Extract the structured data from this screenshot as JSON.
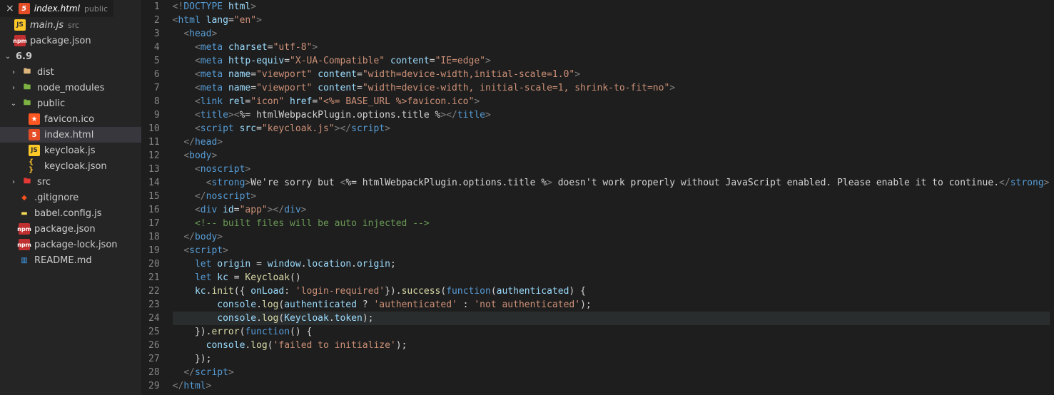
{
  "tabs": {
    "active": {
      "name": "index.html",
      "meta": "public"
    }
  },
  "breadcrumb": {
    "file": "main.js",
    "meta": "src"
  },
  "packagecrumb": {
    "file": "package.json"
  },
  "explorer": {
    "root": "6.9",
    "items": [
      {
        "type": "folder",
        "name": "dist",
        "expanded": false,
        "iconCls": "i-folder"
      },
      {
        "type": "folder",
        "name": "node_modules",
        "expanded": false,
        "iconCls": "i-foldergreen"
      },
      {
        "type": "folder",
        "name": "public",
        "expanded": true,
        "iconCls": "i-foldergreen",
        "children": [
          {
            "name": "favicon.ico",
            "iconCls": "i-fav",
            "glyph": "★"
          },
          {
            "name": "index.html",
            "iconCls": "i-html5",
            "glyph": "5",
            "selected": true
          },
          {
            "name": "keycloak.js",
            "iconCls": "i-js",
            "glyph": "JS"
          },
          {
            "name": "keycloak.json",
            "iconCls": "i-json",
            "glyph": "{ }"
          }
        ]
      },
      {
        "type": "folder",
        "name": "src",
        "expanded": false,
        "iconCls": "i-folderred"
      },
      {
        "type": "file",
        "name": ".gitignore",
        "iconCls": "i-git",
        "glyph": "◆"
      },
      {
        "type": "file",
        "name": "babel.config.js",
        "iconCls": "i-babel",
        "glyph": "▬"
      },
      {
        "type": "file",
        "name": "package.json",
        "iconCls": "i-npm",
        "glyph": "npm"
      },
      {
        "type": "file",
        "name": "package-lock.json",
        "iconCls": "i-npm",
        "glyph": "npm"
      },
      {
        "type": "file",
        "name": "README.md",
        "iconCls": "i-md",
        "glyph": "▥"
      }
    ]
  },
  "code": {
    "currentLine": 24,
    "lines": [
      {
        "n": 1,
        "html": "<span class='tk-pun'>&lt;!</span><span class='tk-doc'>DOCTYPE</span> <span class='tk-attr'>html</span><span class='tk-pun'>&gt;</span>"
      },
      {
        "n": 2,
        "html": "<span class='tk-pun'>&lt;</span><span class='tk-tag'>html</span> <span class='tk-attr'>lang</span><span class='tk-txt'>=</span><span class='tk-str'>\"en\"</span><span class='tk-pun'>&gt;</span>"
      },
      {
        "n": 3,
        "html": "  <span class='tk-pun'>&lt;</span><span class='tk-tag'>head</span><span class='tk-pun'>&gt;</span>"
      },
      {
        "n": 4,
        "html": "    <span class='tk-pun'>&lt;</span><span class='tk-tag'>meta</span> <span class='tk-attr'>charset</span><span class='tk-txt'>=</span><span class='tk-str'>\"utf-8\"</span><span class='tk-pun'>&gt;</span>"
      },
      {
        "n": 5,
        "html": "    <span class='tk-pun'>&lt;</span><span class='tk-tag'>meta</span> <span class='tk-attr'>http-equiv</span><span class='tk-txt'>=</span><span class='tk-str'>\"X-UA-Compatible\"</span> <span class='tk-attr'>content</span><span class='tk-txt'>=</span><span class='tk-str'>\"IE=edge\"</span><span class='tk-pun'>&gt;</span>"
      },
      {
        "n": 6,
        "html": "    <span class='tk-pun'>&lt;</span><span class='tk-tag'>meta</span> <span class='tk-attr'>name</span><span class='tk-txt'>=</span><span class='tk-str'>\"viewport\"</span> <span class='tk-attr'>content</span><span class='tk-txt'>=</span><span class='tk-str'>\"width=device-width,initial-scale=1.0\"</span><span class='tk-pun'>&gt;</span>"
      },
      {
        "n": 7,
        "html": "    <span class='tk-pun'>&lt;</span><span class='tk-tag'>meta</span> <span class='tk-attr'>name</span><span class='tk-txt'>=</span><span class='tk-str'>\"viewport\"</span> <span class='tk-attr'>content</span><span class='tk-txt'>=</span><span class='tk-str'>\"width=device-width, initial-scale=1, shrink-to-fit=no\"</span><span class='tk-pun'>&gt;</span>"
      },
      {
        "n": 8,
        "html": "    <span class='tk-pun'>&lt;</span><span class='tk-tag'>link</span> <span class='tk-attr'>rel</span><span class='tk-txt'>=</span><span class='tk-str'>\"icon\"</span> <span class='tk-attr'>href</span><span class='tk-txt'>=</span><span class='tk-str'>\"&lt;%= BASE_URL %&gt;favicon.ico\"</span><span class='tk-pun'>&gt;</span>"
      },
      {
        "n": 9,
        "html": "    <span class='tk-pun'>&lt;</span><span class='tk-tag'>title</span><span class='tk-pun'>&gt;&lt;</span><span class='tk-txt'>%= htmlWebpackPlugin.options.title %</span><span class='tk-pun'>&gt;&lt;/</span><span class='tk-tag'>title</span><span class='tk-pun'>&gt;</span>"
      },
      {
        "n": 10,
        "html": "    <span class='tk-pun'>&lt;</span><span class='tk-tag'>script</span> <span class='tk-attr'>src</span><span class='tk-txt'>=</span><span class='tk-str'>\"keycloak.js\"</span><span class='tk-pun'>&gt;&lt;/</span><span class='tk-tag'>script</span><span class='tk-pun'>&gt;</span>"
      },
      {
        "n": 11,
        "html": "  <span class='tk-pun'>&lt;/</span><span class='tk-tag'>head</span><span class='tk-pun'>&gt;</span>"
      },
      {
        "n": 12,
        "html": "  <span class='tk-pun'>&lt;</span><span class='tk-tag'>body</span><span class='tk-pun'>&gt;</span>"
      },
      {
        "n": 13,
        "html": "    <span class='tk-pun'>&lt;</span><span class='tk-tag'>noscript</span><span class='tk-pun'>&gt;</span>"
      },
      {
        "n": 14,
        "html": "      <span class='tk-pun'>&lt;</span><span class='tk-tag'>strong</span><span class='tk-pun'>&gt;</span><span class='tk-txt'>We're sorry but </span><span class='tk-pun'>&lt;</span><span class='tk-txt'>%= htmlWebpackPlugin.options.title %</span><span class='tk-pun'>&gt;</span><span class='tk-txt'> doesn't work properly without JavaScript enabled. Please enable it to continue.</span><span class='tk-pun'>&lt;/</span><span class='tk-tag'>strong</span><span class='tk-pun'>&gt;</span>"
      },
      {
        "n": 15,
        "html": "    <span class='tk-pun'>&lt;/</span><span class='tk-tag'>noscript</span><span class='tk-pun'>&gt;</span>"
      },
      {
        "n": 16,
        "html": "    <span class='tk-pun'>&lt;</span><span class='tk-tag'>div</span> <span class='tk-attr'>id</span><span class='tk-txt'>=</span><span class='tk-str'>\"app\"</span><span class='tk-pun'>&gt;&lt;/</span><span class='tk-tag'>div</span><span class='tk-pun'>&gt;</span>"
      },
      {
        "n": 17,
        "html": "    <span class='tk-cm'>&lt;!-- built files will be auto injected --&gt;</span>"
      },
      {
        "n": 18,
        "html": "  <span class='tk-pun'>&lt;/</span><span class='tk-tag'>body</span><span class='tk-pun'>&gt;</span>"
      },
      {
        "n": 19,
        "html": "  <span class='tk-pun'>&lt;</span><span class='tk-tag'>script</span><span class='tk-pun'>&gt;</span>"
      },
      {
        "n": 20,
        "html": "    <span class='tk-kw'>let</span> <span class='tk-var'>origin</span> <span class='tk-txt'>=</span> <span class='tk-var'>window</span><span class='tk-txt'>.</span><span class='tk-var'>location</span><span class='tk-txt'>.</span><span class='tk-var'>origin</span><span class='tk-txt'>;</span>"
      },
      {
        "n": 21,
        "html": "    <span class='tk-kw'>let</span> <span class='tk-var'>kc</span> <span class='tk-txt'>=</span> <span class='tk-fn'>Keycloak</span><span class='tk-txt'>()</span>"
      },
      {
        "n": 22,
        "html": "    <span class='tk-var'>kc</span><span class='tk-txt'>.</span><span class='tk-fn'>init</span><span class='tk-txt'>({ </span><span class='tk-var'>onLoad</span><span class='tk-txt'>: </span><span class='tk-str'>'login-required'</span><span class='tk-txt'>}).</span><span class='tk-fn'>success</span><span class='tk-txt'>(</span><span class='tk-kw'>function</span><span class='tk-txt'>(</span><span class='tk-var'>authenticated</span><span class='tk-txt'>) {</span>"
      },
      {
        "n": 23,
        "html": "        <span class='tk-var'>console</span><span class='tk-txt'>.</span><span class='tk-fn'>log</span><span class='tk-txt'>(</span><span class='tk-var'>authenticated</span><span class='tk-txt'> ? </span><span class='tk-str'>'authenticated'</span><span class='tk-txt'> : </span><span class='tk-str'>'not authenticated'</span><span class='tk-txt'>);</span>"
      },
      {
        "n": 24,
        "html": "        <span class='tk-var'>console</span><span class='tk-txt'>.</span><span class='tk-fn'>log</span><span class='tk-txt'>(</span><span class='tk-var'>Keycloak</span><span class='tk-txt'>.</span><span class='tk-var'>token</span><span class='tk-txt'>);</span>"
      },
      {
        "n": 25,
        "html": "    <span class='tk-txt'>}).</span><span class='tk-fn'>error</span><span class='tk-txt'>(</span><span class='tk-kw'>function</span><span class='tk-txt'>() {</span>"
      },
      {
        "n": 26,
        "html": "      <span class='tk-var'>console</span><span class='tk-txt'>.</span><span class='tk-fn'>log</span><span class='tk-txt'>(</span><span class='tk-str'>'failed to initialize'</span><span class='tk-txt'>);</span>"
      },
      {
        "n": 27,
        "html": "    <span class='tk-txt'>});</span>"
      },
      {
        "n": 28,
        "html": "  <span class='tk-pun'>&lt;/</span><span class='tk-tag'>script</span><span class='tk-pun'>&gt;</span>"
      },
      {
        "n": 29,
        "html": "<span class='tk-pun'>&lt;/</span><span class='tk-tag'>html</span><span class='tk-pun'>&gt;</span>"
      }
    ]
  }
}
